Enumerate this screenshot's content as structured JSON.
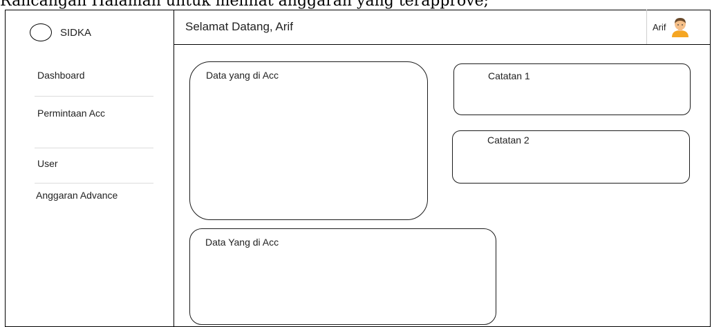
{
  "caption": "Rancangan Halaman untuk melihat anggaran yang terapprove;",
  "app": {
    "name": "SIDKA"
  },
  "sidebar": {
    "items": [
      {
        "label": "Dashboard"
      },
      {
        "label": "Permintaan Acc"
      },
      {
        "label": "User"
      },
      {
        "label": "Anggaran Advance"
      }
    ]
  },
  "header": {
    "welcome": "Selamat Datang, Arif",
    "user_name": "Arif"
  },
  "cards": {
    "data_acc_top": "Data yang di Acc",
    "catatan_1": "Catatan 1",
    "catatan_2": "Catatan 2",
    "data_acc_bottom": "Data Yang di Acc"
  },
  "icons": {
    "brand": "circle-logo-icon",
    "avatar": "user-avatar-icon"
  },
  "colors": {
    "border": "#000000",
    "separator": "#dcdcdc",
    "avatar_skin": "#f6c08a",
    "avatar_shirt": "#f5a623",
    "avatar_hair": "#6b4a2b"
  }
}
